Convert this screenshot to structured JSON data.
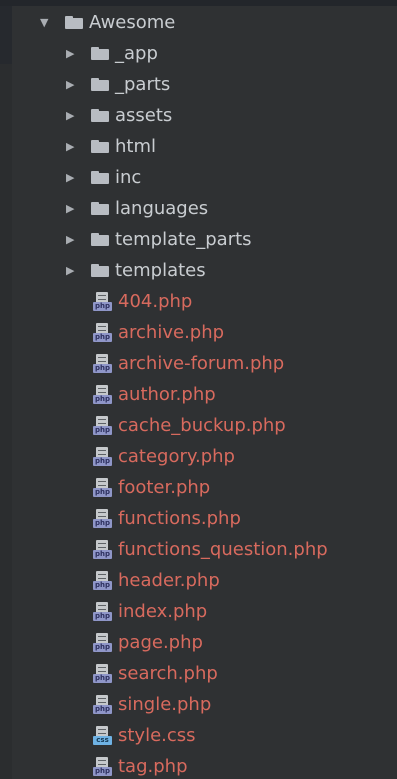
{
  "tree": {
    "root": {
      "label": "Awesome",
      "icon": "folder-icon",
      "expanded": true
    },
    "folders": [
      {
        "label": "_app",
        "icon": "folder-icon",
        "expanded": false
      },
      {
        "label": "_parts",
        "icon": "folder-icon",
        "expanded": false
      },
      {
        "label": "assets",
        "icon": "folder-icon",
        "expanded": false
      },
      {
        "label": "html",
        "icon": "folder-icon",
        "expanded": false
      },
      {
        "label": "inc",
        "icon": "folder-icon",
        "expanded": false
      },
      {
        "label": "languages",
        "icon": "folder-icon",
        "expanded": false
      },
      {
        "label": "template_parts",
        "icon": "folder-icon",
        "expanded": false
      },
      {
        "label": "templates",
        "icon": "folder-icon",
        "expanded": false
      }
    ],
    "files": [
      {
        "label": "404.php",
        "icon": "php-file-icon",
        "badge": "php"
      },
      {
        "label": "archive.php",
        "icon": "php-file-icon",
        "badge": "php"
      },
      {
        "label": "archive-forum.php",
        "icon": "php-file-icon",
        "badge": "php"
      },
      {
        "label": "author.php",
        "icon": "php-file-icon",
        "badge": "php"
      },
      {
        "label": "cache_buckup.php",
        "icon": "php-file-icon",
        "badge": "php"
      },
      {
        "label": "category.php",
        "icon": "php-file-icon",
        "badge": "php"
      },
      {
        "label": "footer.php",
        "icon": "php-file-icon",
        "badge": "php"
      },
      {
        "label": "functions.php",
        "icon": "php-file-icon",
        "badge": "php"
      },
      {
        "label": "functions_question.php",
        "icon": "php-file-icon",
        "badge": "php"
      },
      {
        "label": "header.php",
        "icon": "php-file-icon",
        "badge": "php"
      },
      {
        "label": "index.php",
        "icon": "php-file-icon",
        "badge": "php"
      },
      {
        "label": "page.php",
        "icon": "php-file-icon",
        "badge": "php"
      },
      {
        "label": "search.php",
        "icon": "php-file-icon",
        "badge": "php"
      },
      {
        "label": "single.php",
        "icon": "php-file-icon",
        "badge": "php"
      },
      {
        "label": "style.css",
        "icon": "css-file-icon",
        "badge": "css"
      },
      {
        "label": "tag.php",
        "icon": "php-file-icon",
        "badge": "php"
      }
    ],
    "colors": {
      "background": "#2f3133",
      "folder_text": "#c9cdd1",
      "file_text": "#d86a5e",
      "php_badge": "#8f96c8",
      "css_badge": "#6fb2e4"
    }
  }
}
